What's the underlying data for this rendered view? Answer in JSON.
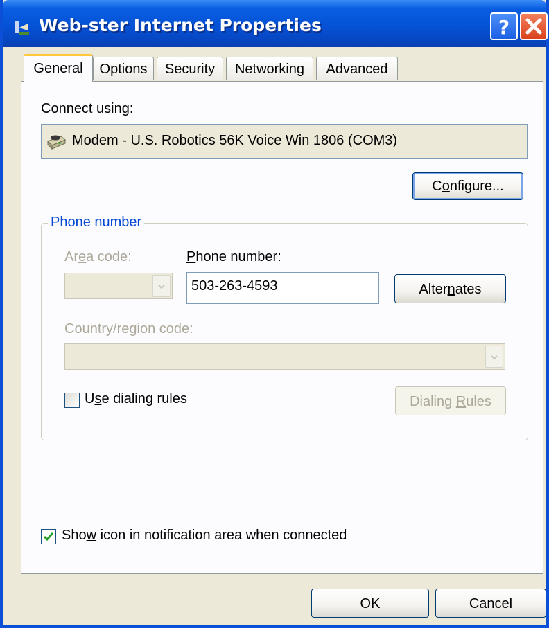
{
  "window": {
    "title": "Web-ster Internet Properties",
    "accent": "#0a4fd6"
  },
  "tabs": [
    {
      "label": "General",
      "selected": true
    },
    {
      "label": "Options",
      "selected": false
    },
    {
      "label": "Security",
      "selected": false
    },
    {
      "label": "Networking",
      "selected": false
    },
    {
      "label": "Advanced",
      "selected": false
    }
  ],
  "general": {
    "connect_using_label": "Connect using:",
    "device": "Modem - U.S. Robotics 56K Voice Win 1806 (COM3)",
    "device_icon": "modem-icon",
    "configure": {
      "pre": "C",
      "key": "o",
      "post": "nfigure..."
    },
    "phone_group_title": "Phone number",
    "area_code": {
      "pre": "Ar",
      "key": "e",
      "post": "a code:",
      "value": "",
      "enabled": false
    },
    "phone_number": {
      "key": "P",
      "post": "hone number:",
      "value": "503-263-4593"
    },
    "alternates": {
      "pre": "Alter",
      "key": "n",
      "post": "ates"
    },
    "country": {
      "pre": "Country/re",
      "key": "g",
      "post": "ion code:",
      "value": "",
      "enabled": false
    },
    "dialing_rules_checkbox": {
      "pre": "U",
      "key": "s",
      "post": "e dialing rules",
      "checked": false
    },
    "dialing_rules_button": {
      "pre": "Dialing ",
      "key": "R",
      "post": "ules",
      "enabled": false
    },
    "show_icon_checkbox": {
      "pre": "Sho",
      "key": "w",
      "post": " icon in notification area when connected",
      "checked": true
    }
  },
  "footer": {
    "ok": "OK",
    "cancel": "Cancel"
  }
}
